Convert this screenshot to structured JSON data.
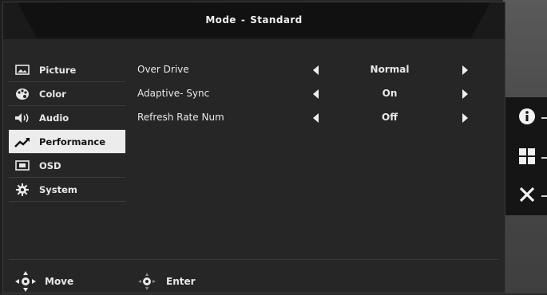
{
  "title": {
    "prefix": "Mode",
    "separator": "-",
    "mode": "Standard"
  },
  "sidebar": {
    "items": [
      {
        "label": "Picture",
        "icon": "picture-icon",
        "selected": false
      },
      {
        "label": "Color",
        "icon": "palette-icon",
        "selected": false
      },
      {
        "label": "Audio",
        "icon": "speaker-icon",
        "selected": false
      },
      {
        "label": "Performance",
        "icon": "performance-trend-icon",
        "selected": true
      },
      {
        "label": "OSD",
        "icon": "osd-screen-icon",
        "selected": false
      },
      {
        "label": "System",
        "icon": "gear-icon",
        "selected": false
      }
    ]
  },
  "settings": {
    "rows": [
      {
        "label": "Over Drive",
        "value": "Normal"
      },
      {
        "label": "Adaptive- Sync",
        "value": "On"
      },
      {
        "label": "Refresh Rate Num",
        "value": "Off"
      }
    ]
  },
  "footer": {
    "move_label": "Move",
    "enter_label": "Enter"
  },
  "side_buttons": [
    {
      "icon": "info-icon"
    },
    {
      "icon": "menu-grid-icon"
    },
    {
      "icon": "close-icon"
    }
  ],
  "colors": {
    "selected_bg": "#ececec",
    "osd_bg": "#262626",
    "title_bg": "#111111"
  }
}
